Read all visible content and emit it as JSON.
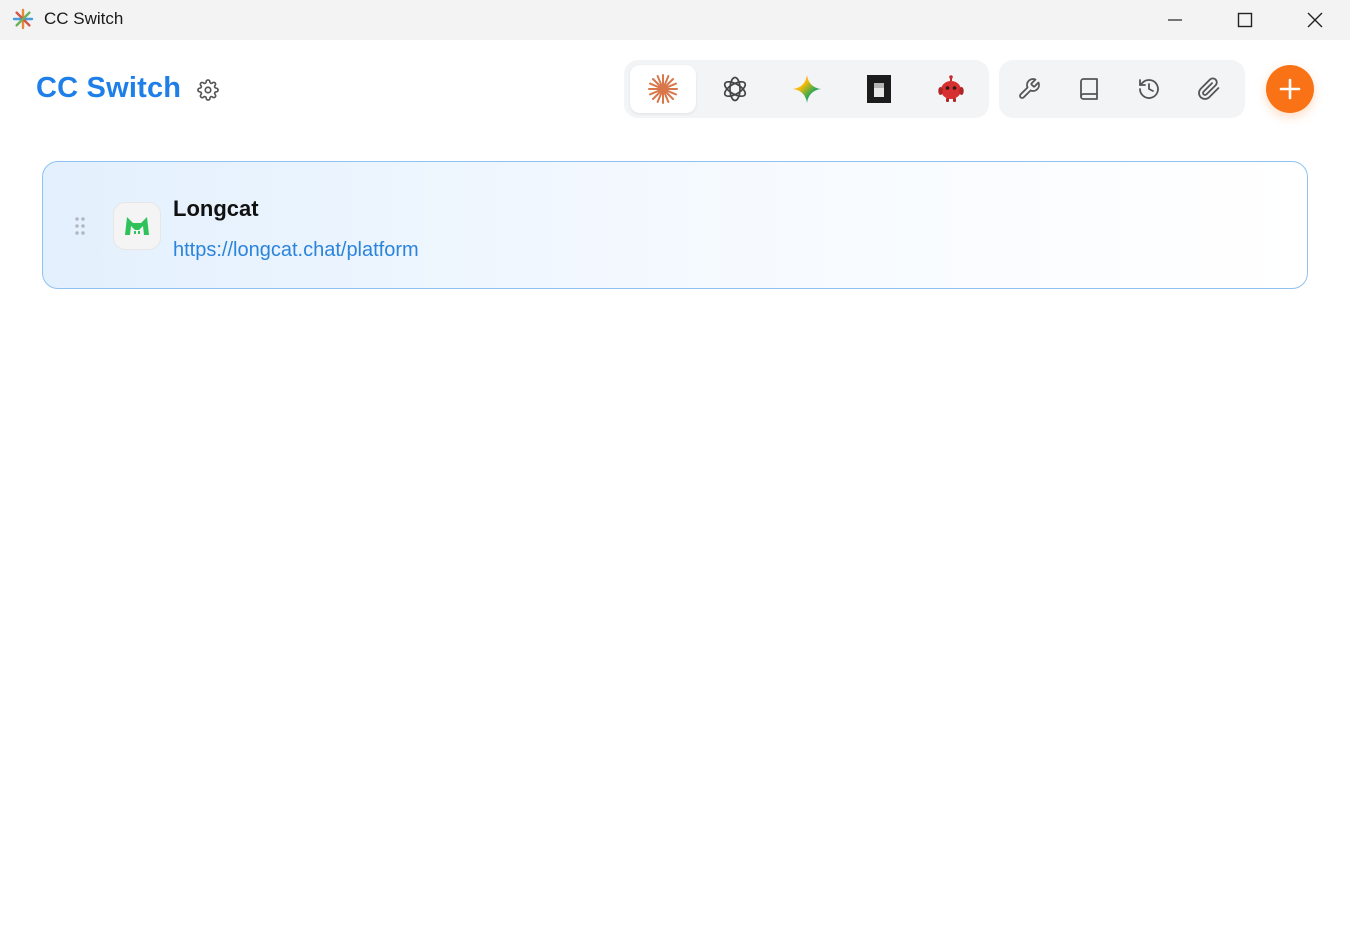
{
  "window": {
    "title": "CC Switch",
    "controls": [
      "minimize-icon",
      "maximize-icon",
      "close-icon"
    ]
  },
  "header": {
    "brand": "CC Switch",
    "settings_icon": "gear-icon"
  },
  "app_tabs": [
    {
      "icon": "claude-icon",
      "active": true
    },
    {
      "icon": "openai-icon",
      "active": false
    },
    {
      "icon": "gemini-icon",
      "active": false
    },
    {
      "icon": "opencode-icon",
      "active": false
    },
    {
      "icon": "robot-icon",
      "active": false
    }
  ],
  "toolbar": {
    "tools": [
      "wrench-icon",
      "book-icon",
      "history-icon",
      "paperclip-icon"
    ],
    "add_icon": "plus-icon"
  },
  "providers": [
    {
      "name": "Longcat",
      "url": "https://longcat.chat/platform",
      "icon": "longcat-icon"
    }
  ],
  "colors": {
    "brand": "#1f7fe8",
    "accent": "#f97316",
    "card_border": "#8fc2f2",
    "link": "#2b84db"
  }
}
